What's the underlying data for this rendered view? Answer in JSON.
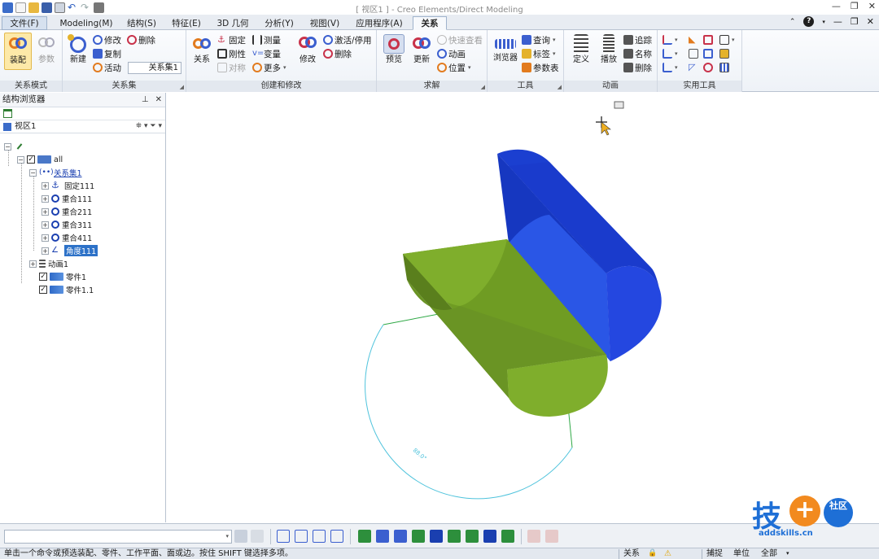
{
  "window": {
    "title": "[ 视区1 ] - Creo Elements/Direct Modeling",
    "controls": [
      "minimize-icon",
      "restore-icon",
      "close-icon"
    ]
  },
  "tabs": [
    {
      "label": "文件(F)",
      "kind": "file"
    },
    {
      "label": "Modeling(M)"
    },
    {
      "label": "结构(S)"
    },
    {
      "label": "特征(E)"
    },
    {
      "label": "3D 几何"
    },
    {
      "label": "分析(Y)"
    },
    {
      "label": "视图(V)"
    },
    {
      "label": "应用程序(A)"
    },
    {
      "label": "关系",
      "active": true
    }
  ],
  "ribbon": {
    "groups": {
      "mode": {
        "label": "关系模式",
        "assembly": "装配",
        "params": "参数"
      },
      "relset": {
        "label": "关系集",
        "new": "新建",
        "modify": "修改",
        "delete": "删除",
        "copy": "复制",
        "active": "活动",
        "current_set": "关系集1"
      },
      "create": {
        "label": "创建和修改",
        "relation": "关系",
        "fixed": "固定",
        "measure": "测量",
        "rigid": "刚性",
        "variable": "变量",
        "symmetric": "对称",
        "more": "更多",
        "modify": "修改",
        "activate": "激活/停用",
        "delete": "删除"
      },
      "solve": {
        "label": "求解",
        "preview": "预览",
        "update": "更新",
        "quick_view": "快速查看",
        "animation": "动画",
        "position": "位置"
      },
      "tools": {
        "label": "工具",
        "browser": "浏览器",
        "query": "查询",
        "annotation": "标签",
        "param_table": "参数表"
      },
      "anim": {
        "label": "动画",
        "define": "定义",
        "play": "播放",
        "track": "追踪",
        "name": "名称",
        "delete": "删除"
      },
      "utils": {
        "label": "实用工具"
      }
    }
  },
  "browser": {
    "title": "结构浏览器",
    "view": "视区1",
    "tree": [
      {
        "label": "all",
        "level": 1,
        "checkbox": true,
        "icon": "assembly-icon"
      },
      {
        "label": "关系集1",
        "level": 2,
        "icon": "relation-set-icon",
        "style": "link"
      },
      {
        "label": "固定111",
        "level": 3,
        "icon": "fix-icon"
      },
      {
        "label": "重合111",
        "level": 3,
        "icon": "coincident-icon"
      },
      {
        "label": "重合211",
        "level": 3,
        "icon": "coincident-icon"
      },
      {
        "label": "重合311",
        "level": 3,
        "icon": "coincident-icon"
      },
      {
        "label": "重合411",
        "level": 3,
        "icon": "coincident-icon"
      },
      {
        "label": "角度111",
        "level": 3,
        "icon": "angle-icon",
        "selected": true
      },
      {
        "label": "动画1",
        "level": 2,
        "icon": "animation-icon"
      },
      {
        "label": "零件1",
        "level": 2,
        "checkbox": true,
        "icon": "part-icon"
      },
      {
        "label": "零件1.1",
        "level": 2,
        "checkbox": true,
        "icon": "part-icon"
      }
    ]
  },
  "viewport": {
    "angle_label": "88.0°",
    "colors": {
      "blue_part": "#1b3fd0",
      "green_part": "#6f9c23",
      "sketch_line": "#2ea845",
      "arc": "#4fc3dc"
    }
  },
  "status": {
    "message": "单击一个命令或预选装配、零件、工作平面、面或边。按住 SHIFT 键选择多项。",
    "relation_mode": "关系",
    "snap": "捕捉",
    "unit": "单位",
    "filter": "全部"
  },
  "watermark": {
    "main": "技",
    "plus": "+",
    "side": "社区",
    "url": "addskills.cn"
  }
}
